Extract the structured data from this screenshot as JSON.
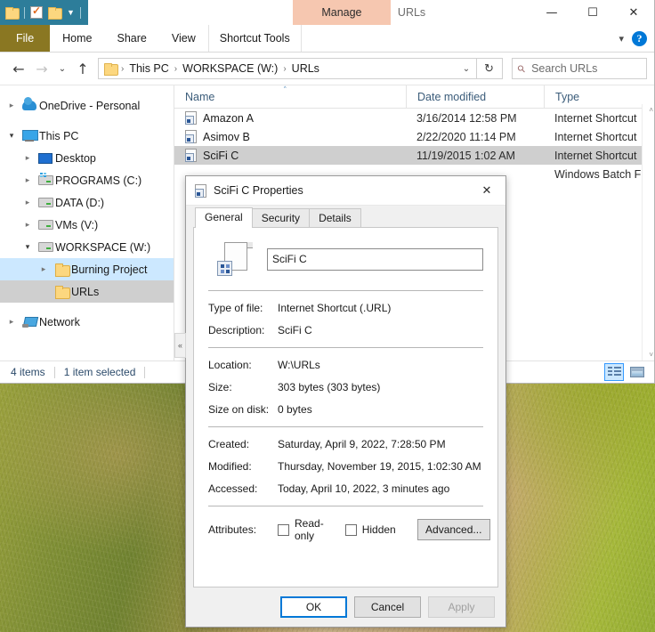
{
  "explorer": {
    "quick_access": {
      "folder_icon": "folder-icon",
      "properties_icon": "properties-checkmark-icon",
      "new_folder_icon": "new-folder-icon",
      "customize_icon": "customize-qat-icon"
    },
    "title": "URLs",
    "contextual_tab_group": "Manage",
    "window_controls": {
      "minimize": "—",
      "maximize": "☐",
      "close": "✕"
    },
    "ribbon": {
      "tabs": [
        {
          "label": "File"
        },
        {
          "label": "Home"
        },
        {
          "label": "Share"
        },
        {
          "label": "View"
        },
        {
          "label": "Shortcut Tools"
        }
      ],
      "collapse_icon": "chevron-down-icon",
      "help_label": "?"
    },
    "address": {
      "back_icon": "←",
      "forward_icon": "→",
      "recent_icon": "⌄",
      "up_icon": "↑",
      "folder_icon": "folder-icon",
      "crumbs": [
        "This PC",
        "WORKSPACE (W:)",
        "URLs"
      ],
      "separator": "›",
      "dropdown_icon": "⌄",
      "refresh_icon": "↻"
    },
    "search": {
      "icon": "search-icon",
      "placeholder": "Search URLs"
    },
    "nav_tree": [
      {
        "label": "OneDrive - Personal",
        "icon": "cloud-icon",
        "indent": 0,
        "expander": "›",
        "state": ""
      },
      {
        "label": "This PC",
        "icon": "pc-icon",
        "indent": 0,
        "expander": "⌄",
        "state": ""
      },
      {
        "label": "Desktop",
        "icon": "desktop-icon",
        "indent": 1,
        "expander": "›",
        "state": ""
      },
      {
        "label": "PROGRAMS (C:)",
        "icon": "system-drive-icon",
        "indent": 1,
        "expander": "›",
        "state": ""
      },
      {
        "label": "DATA (D:)",
        "icon": "drive-icon",
        "indent": 1,
        "expander": "›",
        "state": ""
      },
      {
        "label": "VMs (V:)",
        "icon": "drive-icon",
        "indent": 1,
        "expander": "›",
        "state": ""
      },
      {
        "label": "WORKSPACE (W:)",
        "icon": "drive-icon",
        "indent": 1,
        "expander": "⌄",
        "state": ""
      },
      {
        "label": "Burning Project",
        "icon": "folder-icon",
        "indent": 2,
        "expander": "›",
        "state": "sel-blue"
      },
      {
        "label": "URLs",
        "icon": "folder-icon",
        "indent": 2,
        "expander": "",
        "state": "sel-gray"
      },
      {
        "label": "Network",
        "icon": "network-icon",
        "indent": 0,
        "expander": "›",
        "state": ""
      }
    ],
    "columns": {
      "name": "Name",
      "date_modified": "Date modified",
      "type": "Type",
      "sort_indicator": "˄"
    },
    "files": [
      {
        "name": "Amazon A",
        "date": "3/16/2014 12:58 PM",
        "type": "Internet Shortcut",
        "selected": false
      },
      {
        "name": "Asimov B",
        "date": "2/22/2020 11:14 PM",
        "type": "Internet Shortcut",
        "selected": false
      },
      {
        "name": "SciFi C",
        "date": "11/19/2015 1:02 AM",
        "type": "Internet Shortcut",
        "selected": true
      },
      {
        "name": "",
        "date": "",
        "type": "Windows Batch File",
        "selected": false
      }
    ],
    "status": {
      "item_count": "4 items",
      "selection": "1 item selected"
    },
    "view_buttons": {
      "details_icon": "details-view-icon",
      "large_icons_icon": "large-icons-view-icon"
    },
    "collapse_handle_icon": "«",
    "scroll_up_icon": "˄",
    "scroll_down_icon": "˅"
  },
  "dialog": {
    "title": "SciFi C Properties",
    "title_icon": "url-shortcut-icon",
    "close_icon": "✕",
    "tabs": [
      {
        "label": "General",
        "active": true
      },
      {
        "label": "Security",
        "active": false
      },
      {
        "label": "Details",
        "active": false
      }
    ],
    "file_icon": "url-shortcut-large-icon",
    "filename_value": "SciFi C",
    "fields": [
      {
        "label": "Type of file:",
        "value": "Internet Shortcut (.URL)"
      },
      {
        "label": "Description:",
        "value": "SciFi C"
      }
    ],
    "location_fields": [
      {
        "label": "Location:",
        "value": "W:\\URLs"
      },
      {
        "label": "Size:",
        "value": "303 bytes (303 bytes)"
      },
      {
        "label": "Size on disk:",
        "value": "0 bytes"
      }
    ],
    "time_fields": [
      {
        "label": "Created:",
        "value": "Saturday, April 9, 2022, 7:28:50 PM"
      },
      {
        "label": "Modified:",
        "value": "Thursday, November 19, 2015, 1:02:30 AM"
      },
      {
        "label": "Accessed:",
        "value": "Today, April 10, 2022, 3 minutes ago"
      }
    ],
    "attributes": {
      "label": "Attributes:",
      "readonly_label": "Read-only",
      "readonly_checked": false,
      "hidden_label": "Hidden",
      "hidden_checked": false,
      "advanced_label": "Advanced..."
    },
    "buttons": {
      "ok": "OK",
      "cancel": "Cancel",
      "apply": "Apply",
      "apply_disabled": true
    }
  },
  "colors": {
    "accent": "#0078d7",
    "file_tab": "#8a7722",
    "contextual_tab": "#f6c7b0",
    "selection_gray": "#cfcfcf",
    "selection_blue": "#cce8ff",
    "qat_bar": "#2d7d9a"
  }
}
